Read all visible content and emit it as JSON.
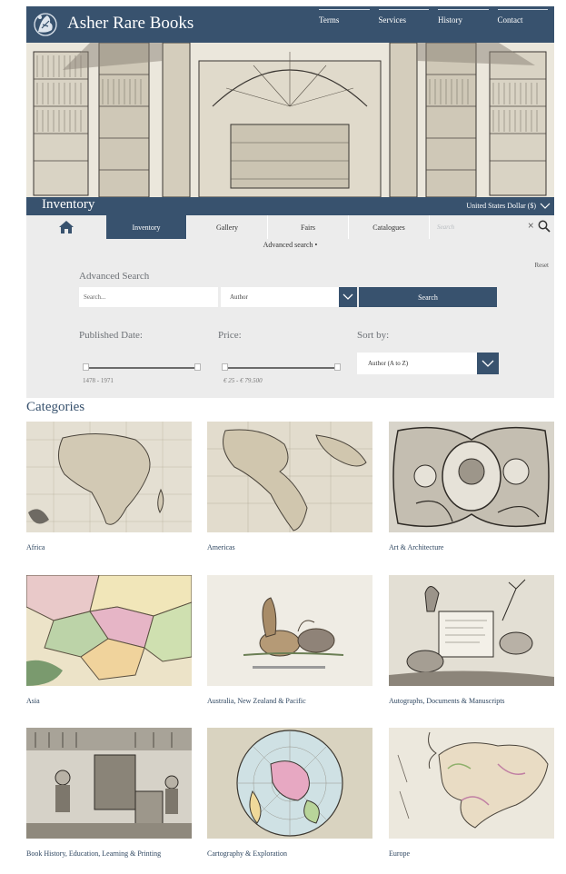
{
  "header": {
    "brand": "Asher Rare Books",
    "nav": [
      "Terms",
      "Services",
      "History",
      "Contact"
    ]
  },
  "hero": {
    "title": "Inventory",
    "currency": "United States Dollar ($)"
  },
  "subnav": {
    "tabs": [
      "Inventory",
      "Gallery",
      "Fairs",
      "Catalogues"
    ],
    "active": "Inventory",
    "search_placeholder": "Search",
    "clear": "×"
  },
  "advanced": {
    "toggle": "Advanced search •",
    "reset": "Reset",
    "heading": "Advanced Search",
    "search_placeholder": "Search...",
    "field_select": "Author",
    "search_button": "Search",
    "published_label": "Published Date:",
    "published_range": "1478 - 1971",
    "price_label": "Price:",
    "price_range": "€ 25 - € 79.500",
    "sort_label": "Sort by:",
    "sort_value": "Author (A to Z)"
  },
  "categories": {
    "heading": "Categories",
    "items": [
      {
        "label": "Africa"
      },
      {
        "label": "Americas"
      },
      {
        "label": "Art & Architecture"
      },
      {
        "label": "Asia"
      },
      {
        "label": "Australia, New Zealand & Pacific"
      },
      {
        "label": "Autographs, Documents & Manuscripts"
      },
      {
        "label": "Book History, Education, Learning & Printing"
      },
      {
        "label": "Cartography & Exploration"
      },
      {
        "label": "Europe"
      }
    ]
  },
  "colors": {
    "brand": "#38526e",
    "panel": "#ececec"
  }
}
